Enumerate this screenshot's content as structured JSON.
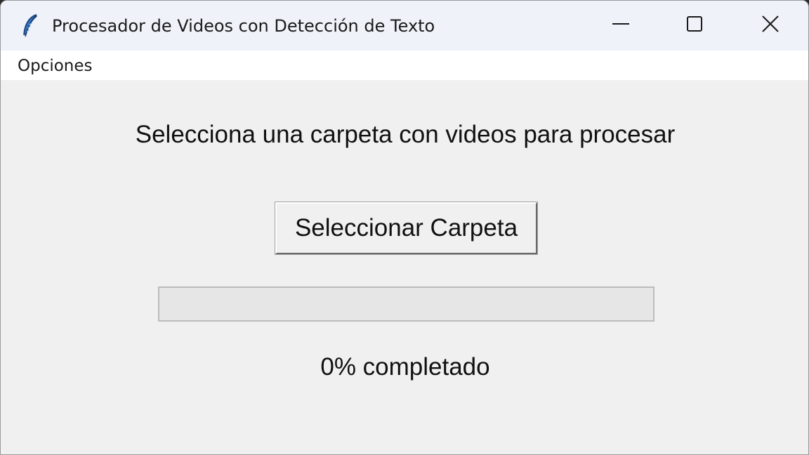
{
  "window": {
    "title": "Procesador de Videos con Detección de Texto",
    "icon": "feather-icon",
    "controls": {
      "minimize": "minimize-icon",
      "maximize": "maximize-icon",
      "close": "close-icon"
    }
  },
  "menubar": {
    "items": [
      {
        "label": "Opciones"
      }
    ]
  },
  "main": {
    "instruction": "Selecciona una carpeta con videos para procesar",
    "select_button_label": "Seleccionar Carpeta",
    "progress": {
      "percent": 0,
      "label": "0% completado"
    }
  },
  "colors": {
    "titlebar_bg": "#eff2f9",
    "window_bg": "#f0f0f0",
    "progress_fill": "#06b025"
  }
}
